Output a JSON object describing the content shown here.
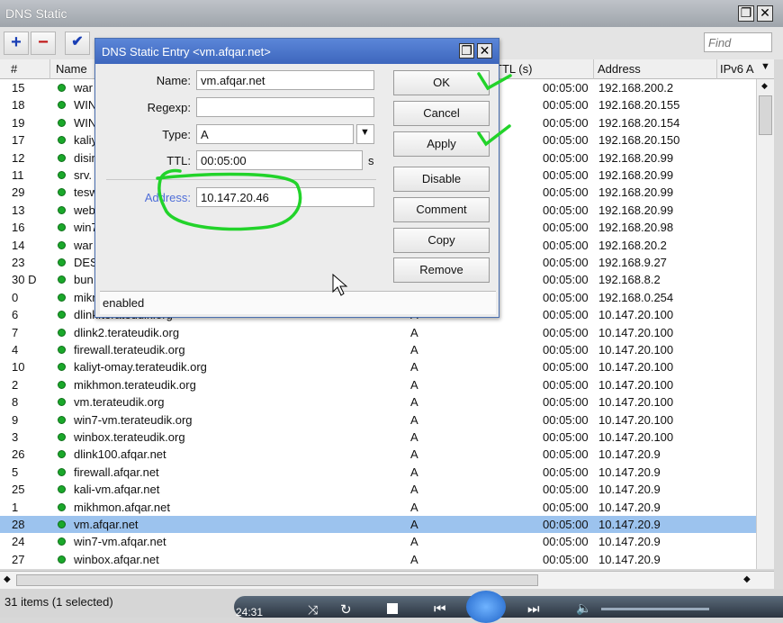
{
  "window": {
    "title": "DNS Static",
    "restore_icon": "restore-icon",
    "close_icon": "close-icon"
  },
  "toolbar": {
    "add_icon": "plus-icon",
    "remove_icon": "minus-icon",
    "enable_icon": "checkmark-icon",
    "find_placeholder": "Find"
  },
  "table": {
    "columns": {
      "num": "#",
      "name": "Name",
      "ttl": "TTL (s)",
      "address": "Address",
      "ipv6": "IPv6 A"
    },
    "rows": [
      {
        "num": "15",
        "name": "war",
        "type": "",
        "ttl": "00:05:00",
        "address": "192.168.200.2"
      },
      {
        "num": "18",
        "name": "WIN",
        "type": "",
        "ttl": "00:05:00",
        "address": "192.168.20.155"
      },
      {
        "num": "19",
        "name": "WIN",
        "type": "",
        "ttl": "00:05:00",
        "address": "192.168.20.154"
      },
      {
        "num": "17",
        "name": "kaliy",
        "type": "",
        "ttl": "00:05:00",
        "address": "192.168.20.150"
      },
      {
        "num": "12",
        "name": "disin",
        "type": "",
        "ttl": "00:05:00",
        "address": "192.168.20.99"
      },
      {
        "num": "11",
        "name": "srv.",
        "type": "",
        "ttl": "00:05:00",
        "address": "192.168.20.99"
      },
      {
        "num": "29",
        "name": "tesw",
        "type": "",
        "ttl": "00:05:00",
        "address": "192.168.20.99"
      },
      {
        "num": "13",
        "name": "web",
        "type": "",
        "ttl": "00:05:00",
        "address": "192.168.20.99"
      },
      {
        "num": "16",
        "name": "win7",
        "type": "",
        "ttl": "00:05:00",
        "address": "192.168.20.98"
      },
      {
        "num": "14",
        "name": "war",
        "type": "",
        "ttl": "00:05:00",
        "address": "192.168.20.2"
      },
      {
        "num": "23",
        "name": "DES",
        "type": "",
        "ttl": "00:05:00",
        "address": "192.168.9.27"
      },
      {
        "num": "30 D",
        "name": "bun",
        "type": "",
        "ttl": "00:05:00",
        "address": "192.168.8.2"
      },
      {
        "num": "0",
        "name": "mikr",
        "type": "",
        "ttl": "00:05:00",
        "address": "192.168.0.254"
      },
      {
        "num": "6",
        "name": "dlink.terateudik.org",
        "type": "A",
        "ttl": "00:05:00",
        "address": "10.147.20.100"
      },
      {
        "num": "7",
        "name": "dlink2.terateudik.org",
        "type": "A",
        "ttl": "00:05:00",
        "address": "10.147.20.100"
      },
      {
        "num": "4",
        "name": "firewall.terateudik.org",
        "type": "A",
        "ttl": "00:05:00",
        "address": "10.147.20.100"
      },
      {
        "num": "10",
        "name": "kaliyt-omay.terateudik.org",
        "type": "A",
        "ttl": "00:05:00",
        "address": "10.147.20.100"
      },
      {
        "num": "2",
        "name": "mikhmon.terateudik.org",
        "type": "A",
        "ttl": "00:05:00",
        "address": "10.147.20.100"
      },
      {
        "num": "8",
        "name": "vm.terateudik.org",
        "type": "A",
        "ttl": "00:05:00",
        "address": "10.147.20.100"
      },
      {
        "num": "9",
        "name": "win7-vm.terateudik.org",
        "type": "A",
        "ttl": "00:05:00",
        "address": "10.147.20.100"
      },
      {
        "num": "3",
        "name": "winbox.terateudik.org",
        "type": "A",
        "ttl": "00:05:00",
        "address": "10.147.20.100"
      },
      {
        "num": "26",
        "name": "dlink100.afqar.net",
        "type": "A",
        "ttl": "00:05:00",
        "address": "10.147.20.9"
      },
      {
        "num": "5",
        "name": "firewall.afqar.net",
        "type": "A",
        "ttl": "00:05:00",
        "address": "10.147.20.9"
      },
      {
        "num": "25",
        "name": "kali-vm.afqar.net",
        "type": "A",
        "ttl": "00:05:00",
        "address": "10.147.20.9"
      },
      {
        "num": "1",
        "name": "mikhmon.afqar.net",
        "type": "A",
        "ttl": "00:05:00",
        "address": "10.147.20.9"
      },
      {
        "num": "28",
        "name": "vm.afqar.net",
        "type": "A",
        "ttl": "00:05:00",
        "address": "10.147.20.9",
        "selected": true
      },
      {
        "num": "24",
        "name": "win7-vm.afqar.net",
        "type": "A",
        "ttl": "00:05:00",
        "address": "10.147.20.9"
      },
      {
        "num": "27",
        "name": "winbox.afqar.net",
        "type": "A",
        "ttl": "00:05:00",
        "address": "10.147.20.9"
      }
    ]
  },
  "status": {
    "count": "31 items (1 selected)",
    "media_time": "24:31"
  },
  "dialog": {
    "title": "DNS Static Entry <vm.afqar.net>",
    "fields": {
      "name_label": "Name:",
      "name_value": "vm.afqar.net",
      "regexp_label": "Regexp:",
      "regexp_value": "",
      "type_label": "Type:",
      "type_value": "A",
      "ttl_label": "TTL:",
      "ttl_value": "00:05:00",
      "ttl_unit": "s",
      "address_label": "Address:",
      "address_value": "10.147.20.46"
    },
    "buttons": {
      "ok": "OK",
      "cancel": "Cancel",
      "apply": "Apply",
      "disable": "Disable",
      "comment": "Comment",
      "copy": "Copy",
      "remove": "Remove"
    },
    "status": "enabled"
  },
  "colors": {
    "selection": "#9cc3ee",
    "dialog_title": "#3d66bd",
    "annotation": "#22d32a",
    "enabled_dot": "#1aa82a"
  }
}
